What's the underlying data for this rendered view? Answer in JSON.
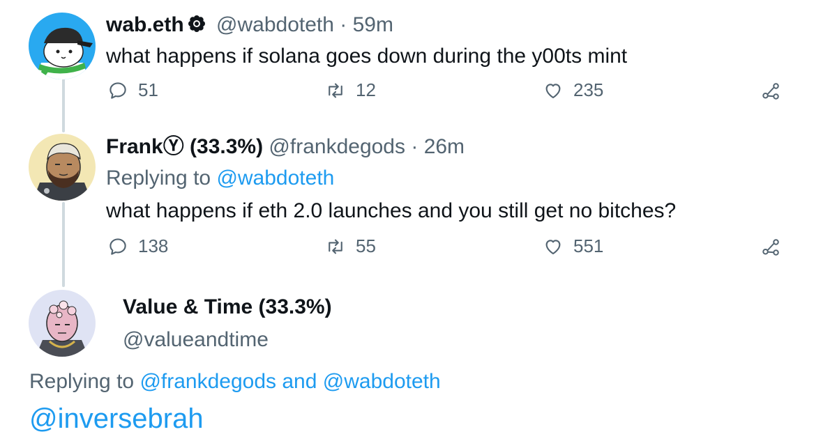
{
  "tweets": [
    {
      "name": "wab.eth",
      "handle": "@wabdoteth",
      "separator": "·",
      "time": "59m",
      "text": "what happens if solana goes down during the y00ts mint",
      "replies": "51",
      "retweets": "12",
      "likes": "235"
    },
    {
      "name": "FrankⓎ (33.3%)",
      "handle": "@frankdegods",
      "separator": "·",
      "time": "26m",
      "replying_label": "Replying to",
      "replying_to": "@wabdoteth",
      "text": "what happens if eth 2.0 launches and you still get no bitches?",
      "replies": "138",
      "retweets": "55",
      "likes": "551"
    }
  ],
  "reply": {
    "name": "Value & Time (33.3%)",
    "handle": "@valueandtime",
    "replying_label": "Replying to",
    "replying_to_1": "@frankdegods",
    "and_label": "and",
    "replying_to_2": "@wabdoteth",
    "text": "@inversebrah"
  },
  "colors": {
    "text": "#0f1419",
    "muted": "#536471",
    "link": "#1d9bf0",
    "thread_line": "#cfd9de"
  },
  "icons": [
    "reply-icon",
    "retweet-icon",
    "like-icon",
    "share-icon",
    "verified-badge-icon"
  ]
}
